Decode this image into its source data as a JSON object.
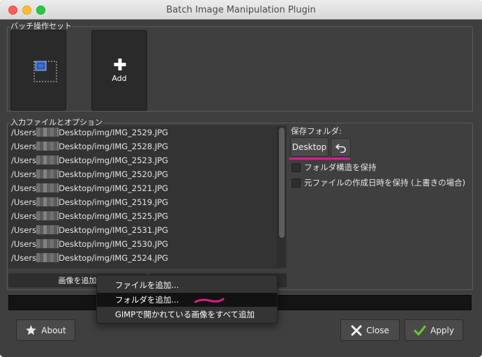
{
  "window": {
    "title": "Batch Image Manipulation Plugin"
  },
  "batch_set": {
    "label": "バッチ操作セット",
    "add_tile_label": "Add"
  },
  "input_files": {
    "label": "入力ファイルとオプション",
    "files": [
      {
        "prefix": "/Users",
        "suffix": "Desktop/img/IMG_2529.JPG"
      },
      {
        "prefix": "/Users",
        "suffix": "Desktop/img/IMG_2528.JPG"
      },
      {
        "prefix": "/Users",
        "suffix": "Desktop/img/IMG_2523.JPG"
      },
      {
        "prefix": "/Users",
        "suffix": "Desktop/img/IMG_2520.JPG"
      },
      {
        "prefix": "/Users",
        "suffix": "Desktop/img/IMG_2521.JPG"
      },
      {
        "prefix": "/Users",
        "suffix": "Desktop/img/IMG_2519.JPG"
      },
      {
        "prefix": "/Users",
        "suffix": "Desktop/img/IMG_2525.JPG"
      },
      {
        "prefix": "/Users",
        "suffix": "Desktop/img/IMG_2531.JPG"
      },
      {
        "prefix": "/Users",
        "suffix": "Desktop/img/IMG_2530.JPG"
      },
      {
        "prefix": "/Users",
        "suffix": "Desktop/img/IMG_2524.JPG"
      }
    ],
    "add_images_button": "画像を追加"
  },
  "output": {
    "save_folder_label": "保存フォルダ:",
    "folder_button": "Desktop",
    "keep_structure_label": "フォルダ構造を保持",
    "keep_dates_label": "元ファイルの作成日時を保持 (上書きの場合)"
  },
  "add_menu": {
    "items": [
      "ファイルを追加...",
      "フォルダを追加...",
      "GIMPで開かれている画像をすべて追加"
    ],
    "selected_index": 1
  },
  "footer": {
    "about_button": "About",
    "close_button": "Close",
    "apply_button": "Apply"
  },
  "colors": {
    "annotation": "#e01a8e",
    "background": "#3f3f3f"
  }
}
